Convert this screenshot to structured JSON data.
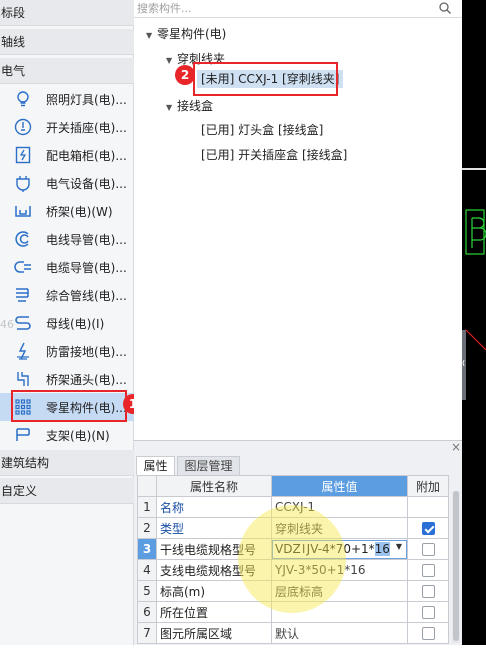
{
  "left_panel": {
    "categories": {
      "segment": "标段",
      "axis": "轴线",
      "electrical": "电气",
      "building": "建筑结构",
      "custom": "自定义"
    },
    "items": [
      {
        "label": "照明灯具(电)...",
        "icon": "bulb-icon"
      },
      {
        "label": "开关插座(电)...",
        "icon": "switch-socket-icon"
      },
      {
        "label": "配电箱柜(电)...",
        "icon": "distribution-box-icon"
      },
      {
        "label": "电气设备(电)...",
        "icon": "electrical-device-icon"
      },
      {
        "label": "桥架(电)(W)",
        "icon": "cable-tray-icon"
      },
      {
        "label": "电线导管(电)...",
        "icon": "wire-conduit-icon"
      },
      {
        "label": "电缆导管(电)...",
        "icon": "cable-conduit-icon"
      },
      {
        "label": "综合管线(电)...",
        "icon": "integrated-pipeline-icon"
      },
      {
        "label": "母线(电)(I)",
        "icon": "busbar-icon"
      },
      {
        "label": "防雷接地(电)...",
        "icon": "lightning-ground-icon"
      },
      {
        "label": "桥架通头(电)...",
        "icon": "tray-fitting-icon"
      },
      {
        "label": "零星构件(电)...",
        "icon": "grid-dots-icon"
      },
      {
        "label": "支架(电)(N)",
        "icon": "bracket-icon"
      }
    ],
    "faint_number": "46",
    "badge_1": "1"
  },
  "tree": {
    "search_placeholder": "搜索构件...",
    "root": "零星构件(电)",
    "group1": "穿刺线夹",
    "group1_item": "[未用] CCXJ-1 [穿刺线夹]",
    "group2": "接线盒",
    "group2_items": [
      "[已用] 灯头盒 [接线盒]",
      "[已用] 开关插座盒 [接线盒]"
    ],
    "badge_2": "2"
  },
  "properties": {
    "close_glyph": "×",
    "tabs": [
      "属性",
      "图层管理"
    ],
    "headers": {
      "num": "",
      "name": "属性名称",
      "value": "属性值",
      "extra": "附加"
    },
    "rows": [
      {
        "num": "1",
        "name": "名称",
        "value": "CCXJ-1",
        "checked": null
      },
      {
        "num": "2",
        "name": "类型",
        "value": "穿刺线夹",
        "checked": true
      },
      {
        "num": "3",
        "name": "干线电缆规格型号",
        "value_prefix": "VDZ",
        "value_mid": "JV-4*70+1*",
        "value_hl": "16",
        "checked": false
      },
      {
        "num": "4",
        "name": "支线电缆规格型号",
        "value": "YJV-3*50+1*16",
        "checked": false
      },
      {
        "num": "5",
        "name": "标高(m)",
        "value": "层底标高",
        "checked": false
      },
      {
        "num": "6",
        "name": "所在位置",
        "value": "",
        "checked": false
      },
      {
        "num": "7",
        "name": "图元所属区域",
        "value": "默认",
        "checked": false
      }
    ]
  },
  "colors": {
    "highlight_red": "#e8262a",
    "header_blue": "#5c9ce0",
    "cursor_yellow": "#f7e64a"
  }
}
